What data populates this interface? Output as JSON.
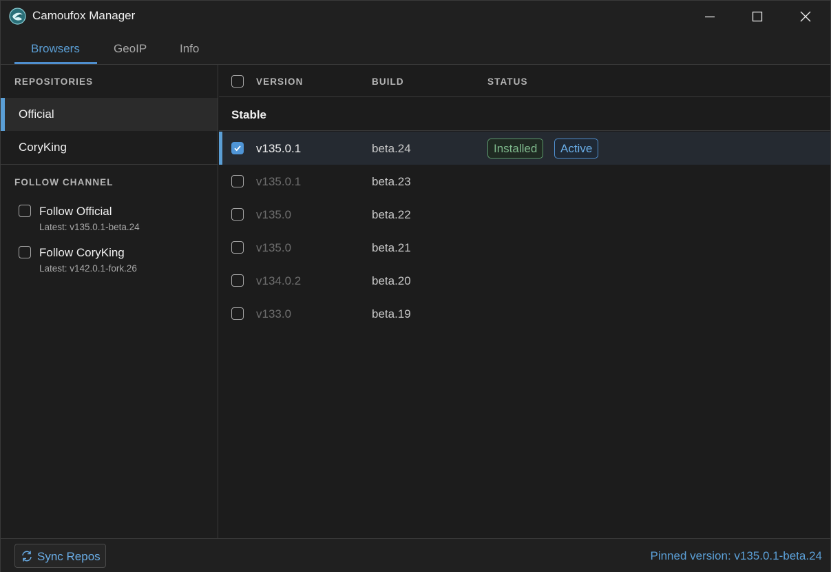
{
  "window": {
    "title": "Camoufox Manager",
    "controls": [
      "minimize",
      "maximize",
      "close"
    ]
  },
  "tabs": [
    {
      "label": "Browsers",
      "active": true
    },
    {
      "label": "GeoIP",
      "active": false
    },
    {
      "label": "Info",
      "active": false
    }
  ],
  "sidebar": {
    "repositories_heading": "REPOSITORIES",
    "repositories": [
      {
        "label": "Official",
        "selected": true
      },
      {
        "label": "CoryKing",
        "selected": false
      }
    ],
    "follow_heading": "FOLLOW CHANNEL",
    "follow": [
      {
        "label": "Follow Official",
        "latest": "Latest: v135.0.1-beta.24",
        "checked": false
      },
      {
        "label": "Follow CoryKing",
        "latest": "Latest: v142.0.1-fork.26",
        "checked": false
      }
    ]
  },
  "table": {
    "columns": {
      "version": "VERSION",
      "build": "BUILD",
      "status": "STATUS"
    },
    "group": "Stable",
    "rows": [
      {
        "version": "v135.0.1",
        "build": "beta.24",
        "checked": true,
        "selected": true,
        "badges": [
          "Installed",
          "Active"
        ]
      },
      {
        "version": "v135.0.1",
        "build": "beta.23",
        "checked": false,
        "selected": false,
        "badges": []
      },
      {
        "version": "v135.0",
        "build": "beta.22",
        "checked": false,
        "selected": false,
        "badges": []
      },
      {
        "version": "v135.0",
        "build": "beta.21",
        "checked": false,
        "selected": false,
        "badges": []
      },
      {
        "version": "v134.0.2",
        "build": "beta.20",
        "checked": false,
        "selected": false,
        "badges": []
      },
      {
        "version": "v133.0",
        "build": "beta.19",
        "checked": false,
        "selected": false,
        "badges": []
      }
    ]
  },
  "footer": {
    "sync_label": "Sync Repos",
    "pinned": "Pinned version: v135.0.1-beta.24"
  },
  "colors": {
    "accent": "#5b9fd6",
    "installed": "#7fb98c",
    "background": "#1c1c1c"
  }
}
